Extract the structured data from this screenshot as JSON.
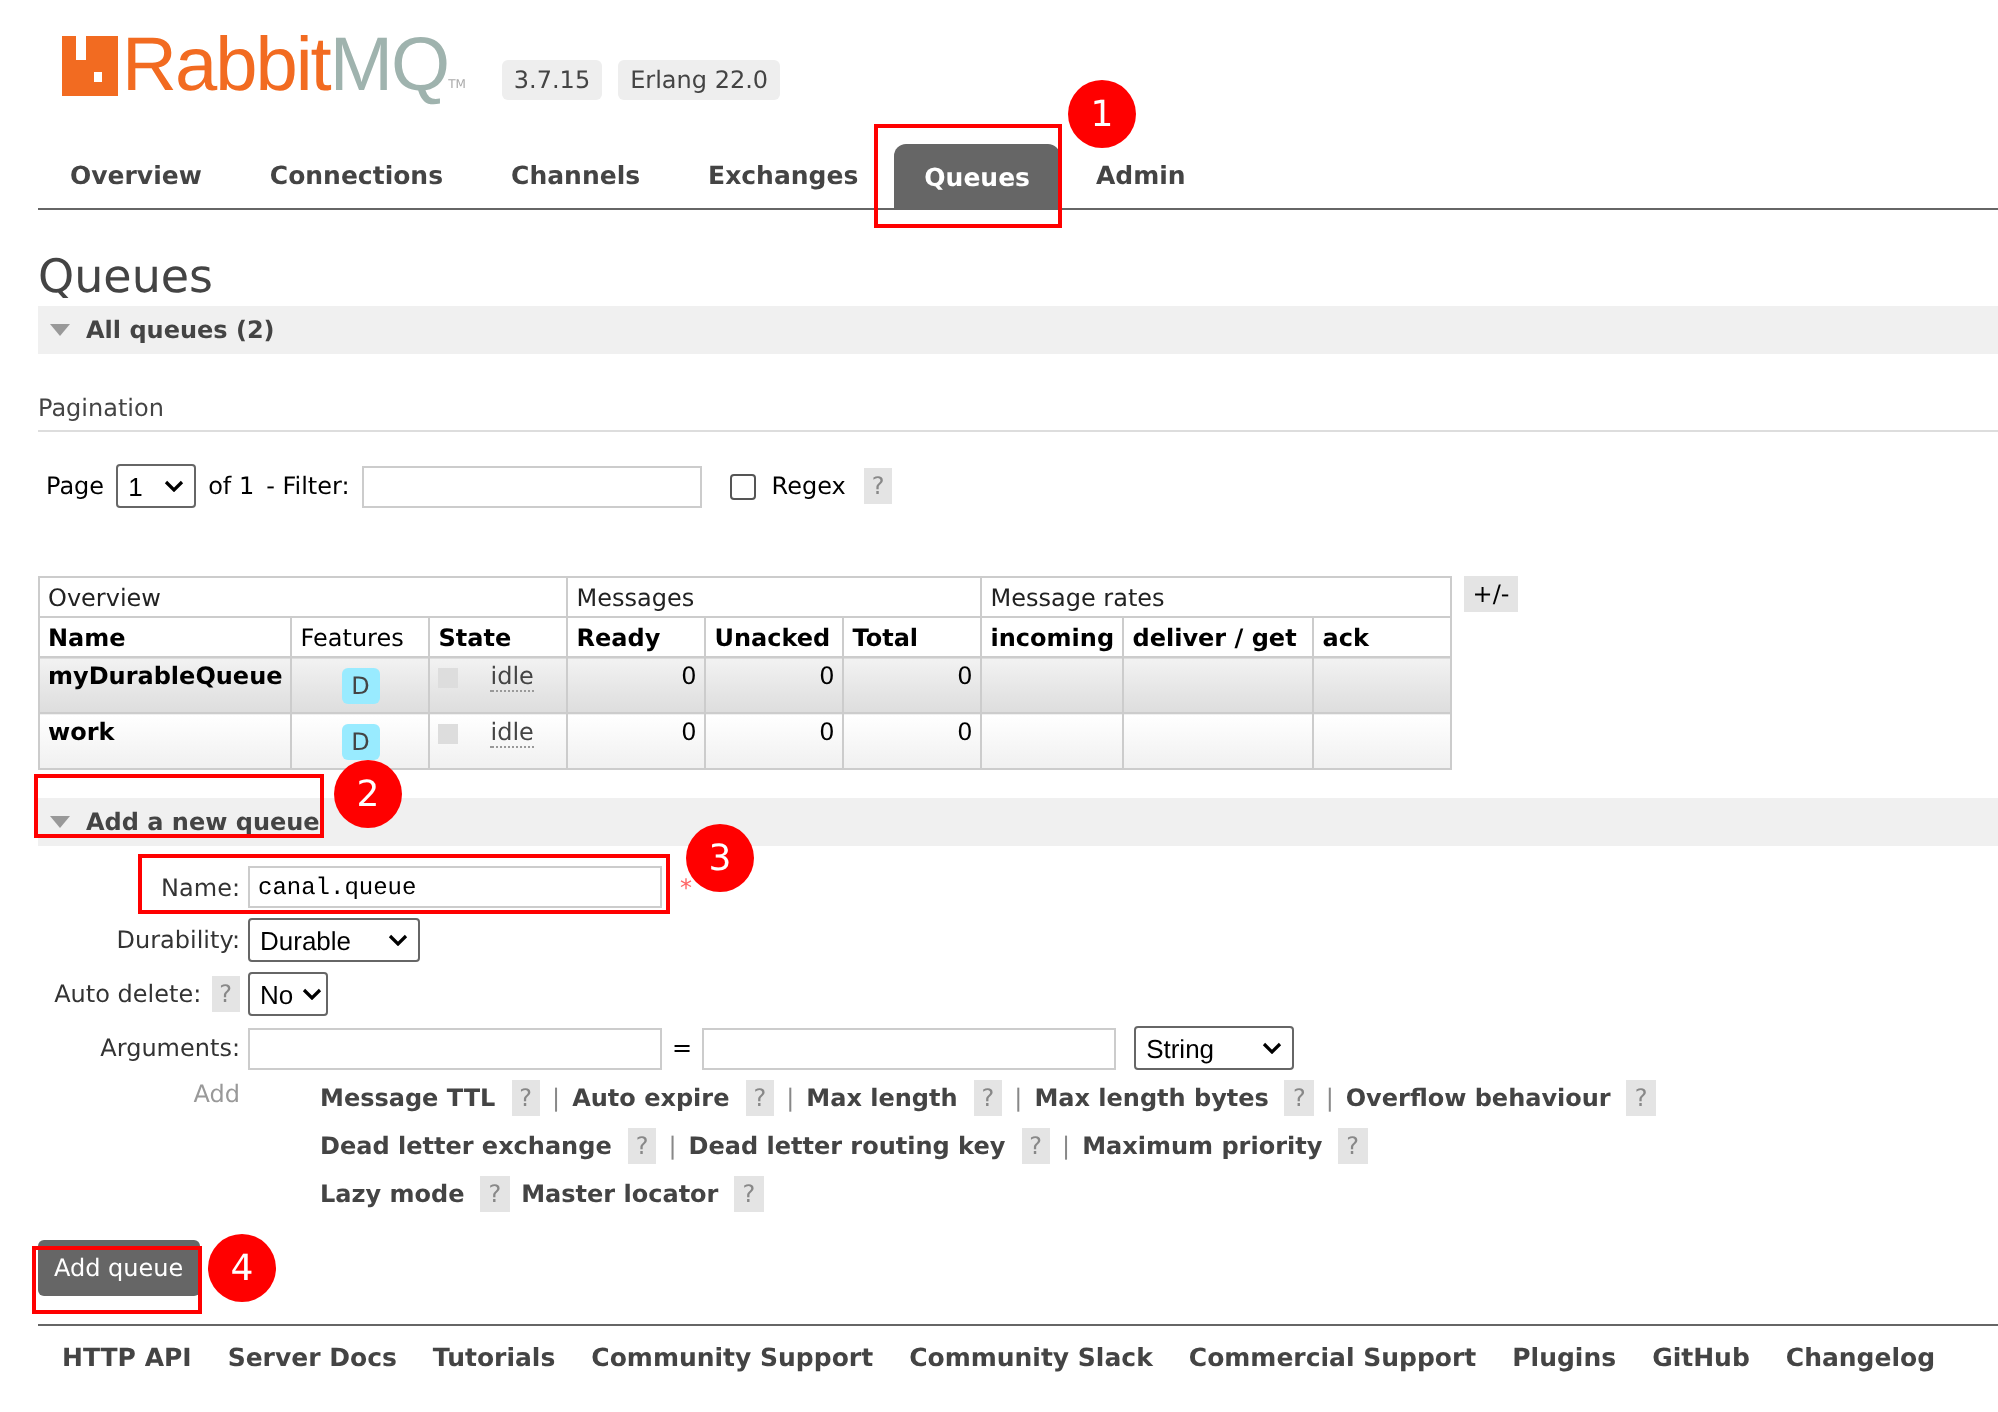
{
  "logo": {
    "primary": "Rabbit",
    "secondary": "MQ",
    "trademark": "TM"
  },
  "version_badges": [
    "3.7.15",
    "Erlang 22.0"
  ],
  "nav_tabs": [
    {
      "label": "Overview",
      "selected": false
    },
    {
      "label": "Connections",
      "selected": false
    },
    {
      "label": "Channels",
      "selected": false
    },
    {
      "label": "Exchanges",
      "selected": false
    },
    {
      "label": "Queues",
      "selected": true
    },
    {
      "label": "Admin",
      "selected": false
    }
  ],
  "page_title": "Queues",
  "all_queues_section": {
    "title": "All queues (2)",
    "expanded": true
  },
  "pagination": {
    "heading": "Pagination",
    "page_label": "Page",
    "page_value": "1",
    "of_label": "of 1",
    "filter_label": "- Filter:",
    "regex_label": "Regex",
    "regex_checked": false,
    "help": "?"
  },
  "table": {
    "groups": [
      "Overview",
      "Messages",
      "Message rates"
    ],
    "columns": [
      "Name",
      "Features",
      "State",
      "Ready",
      "Unacked",
      "Total",
      "incoming",
      "deliver / get",
      "ack"
    ],
    "toggle": "+/-",
    "rows": [
      {
        "name": "myDurableQueue",
        "features": "D",
        "state": "idle",
        "ready": "0",
        "unacked": "0",
        "total": "0"
      },
      {
        "name": "work",
        "features": "D",
        "state": "idle",
        "ready": "0",
        "unacked": "0",
        "total": "0"
      }
    ]
  },
  "add_queue_section": {
    "title": "Add a new queue",
    "expanded": true,
    "name_label": "Name:",
    "name_value": "canal.queue",
    "required_mark": "*",
    "durability_label": "Durability:",
    "durability_value": "Durable",
    "auto_delete_label": "Auto delete:",
    "auto_delete_help": "?",
    "auto_delete_value": "No",
    "arguments_label": "Arguments:",
    "equals": "=",
    "type_value": "String",
    "add_label": "Add",
    "argument_lines": [
      [
        {
          "label": "Message TTL",
          "help": "?",
          "separator": "|"
        },
        {
          "label": "Auto expire",
          "help": "?",
          "separator": "|"
        },
        {
          "label": "Max length",
          "help": "?",
          "separator": "|"
        },
        {
          "label": "Max length bytes",
          "help": "?",
          "separator": "|"
        },
        {
          "label": "Overflow behaviour",
          "help": "?"
        }
      ],
      [
        {
          "label": "Dead letter exchange",
          "help": "?",
          "separator": "|"
        },
        {
          "label": "Dead letter routing key",
          "help": "?",
          "separator": "|"
        },
        {
          "label": "Maximum priority",
          "help": "?"
        }
      ],
      [
        {
          "label": "Lazy mode",
          "help": "?"
        },
        {
          "label": "Master locator",
          "help": "?"
        }
      ]
    ],
    "submit": "Add queue"
  },
  "annotations": [
    "1",
    "2",
    "3",
    "4"
  ],
  "footer_links": [
    "HTTP API",
    "Server Docs",
    "Tutorials",
    "Community Support",
    "Community Slack",
    "Commercial Support",
    "Plugins",
    "GitHub",
    "Changelog"
  ]
}
